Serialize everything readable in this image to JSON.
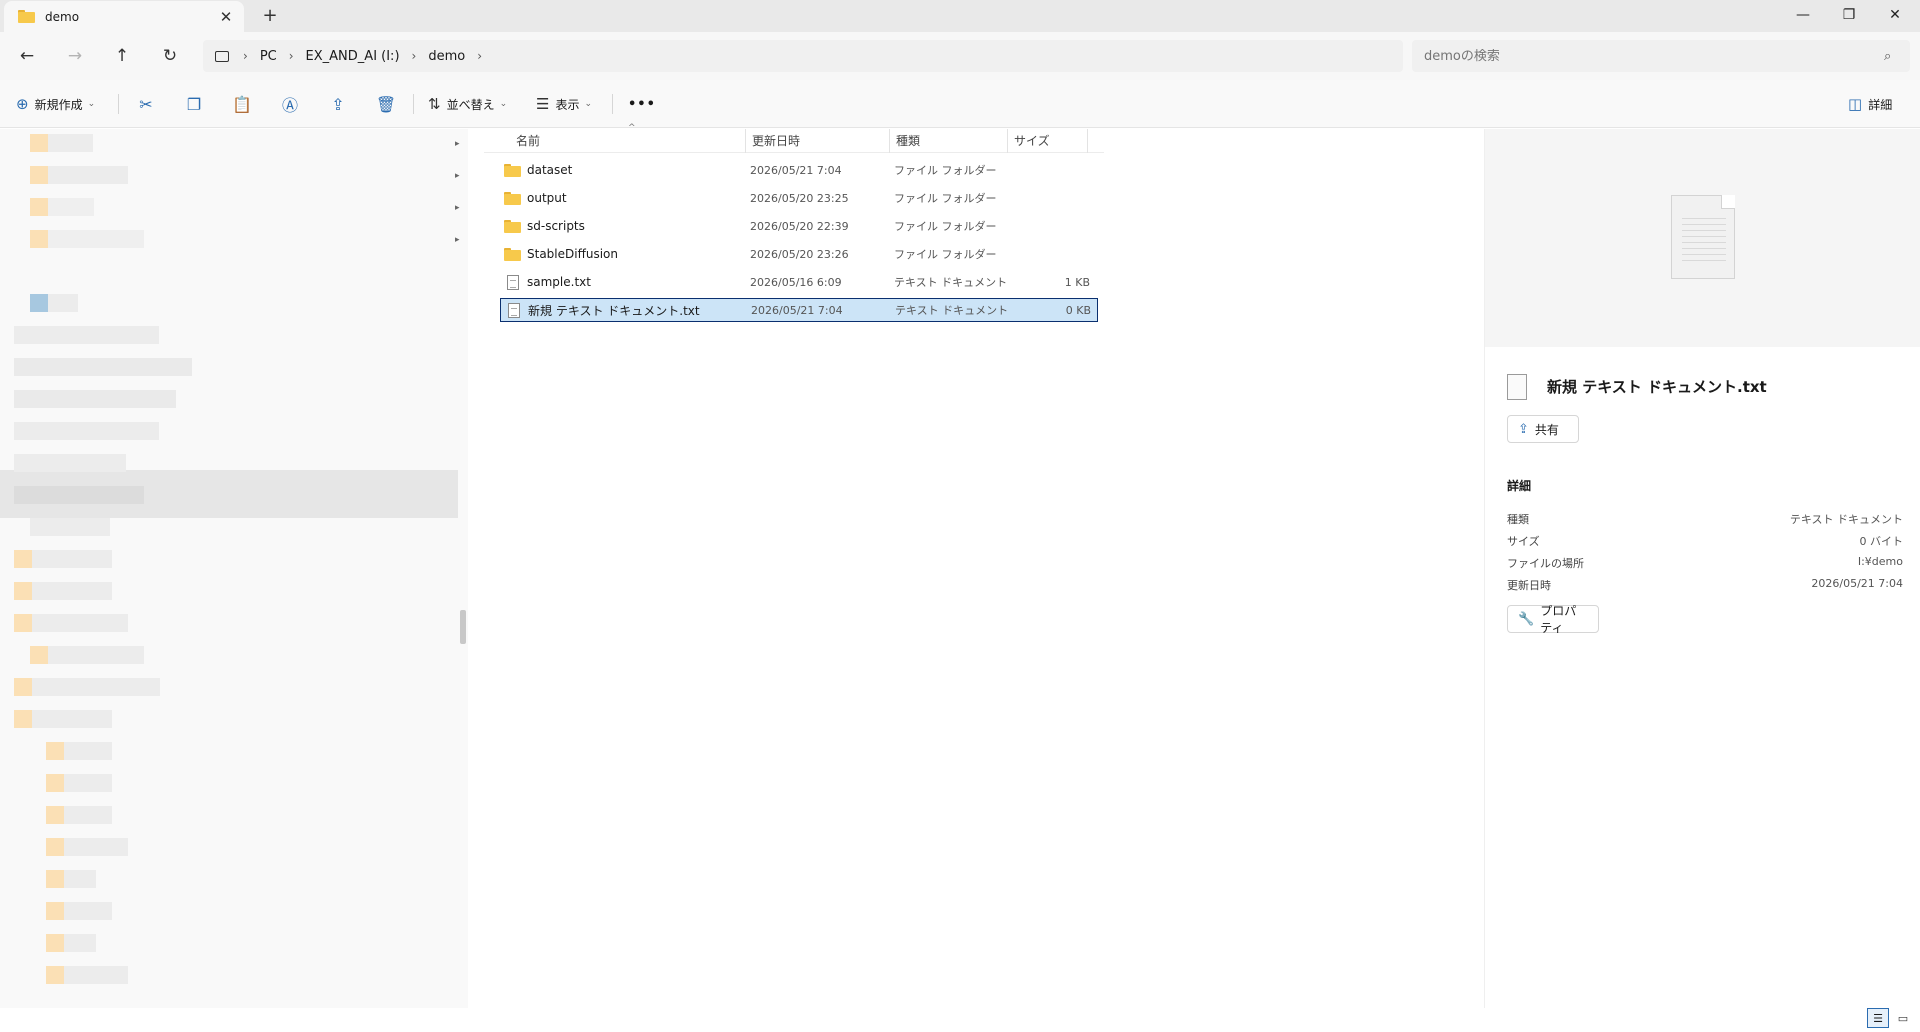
{
  "window": {
    "tab_title": "demo",
    "tab_close": "✕",
    "new_tab": "+",
    "minimize": "—",
    "maximize": "❐",
    "close": "✕"
  },
  "address": {
    "crumbs": [
      "PC",
      "EX_AND_AI (I:)",
      "demo"
    ],
    "search_placeholder": "demoの検索"
  },
  "commands": {
    "new": "新規作成",
    "sort": "並べ替え",
    "view": "表示",
    "more": "•••",
    "details": "詳細"
  },
  "columns": {
    "name": "名前",
    "date": "更新日時",
    "type": "種類",
    "size": "サイズ"
  },
  "files": [
    {
      "name": "dataset",
      "date": "2026/05/21 7:04",
      "type": "ファイル フォルダー",
      "size": "",
      "kind": "folder"
    },
    {
      "name": "output",
      "date": "2026/05/20 23:25",
      "type": "ファイル フォルダー",
      "size": "",
      "kind": "folder"
    },
    {
      "name": "sd-scripts",
      "date": "2026/05/20 22:39",
      "type": "ファイル フォルダー",
      "size": "",
      "kind": "folder"
    },
    {
      "name": "StableDiffusion",
      "date": "2026/05/20 23:26",
      "type": "ファイル フォルダー",
      "size": "",
      "kind": "folder"
    },
    {
      "name": "sample.txt",
      "date": "2026/05/16 6:09",
      "type": "テキスト ドキュメント",
      "size": "1 KB",
      "kind": "file"
    },
    {
      "name": "新規 テキスト ドキュメント.txt",
      "date": "2026/05/21 7:04",
      "type": "テキスト ドキュメント",
      "size": "0 KB",
      "kind": "file",
      "selected": true
    }
  ],
  "details_pane": {
    "file_title": "新規 テキスト ドキュメント.txt",
    "share": "共有",
    "heading": "詳細",
    "properties": [
      {
        "key": "種類",
        "value": "テキスト ドキュメント"
      },
      {
        "key": "サイズ",
        "value": "0 バイト"
      },
      {
        "key": "ファイルの場所",
        "value": "I:¥demo"
      },
      {
        "key": "更新日時",
        "value": "2026/05/21 7:04"
      }
    ],
    "properties_button": "プロパティ"
  },
  "colors": {
    "accent": "#2b6cb0",
    "selection": "#cce4f7",
    "folder": "#f7c94b"
  }
}
